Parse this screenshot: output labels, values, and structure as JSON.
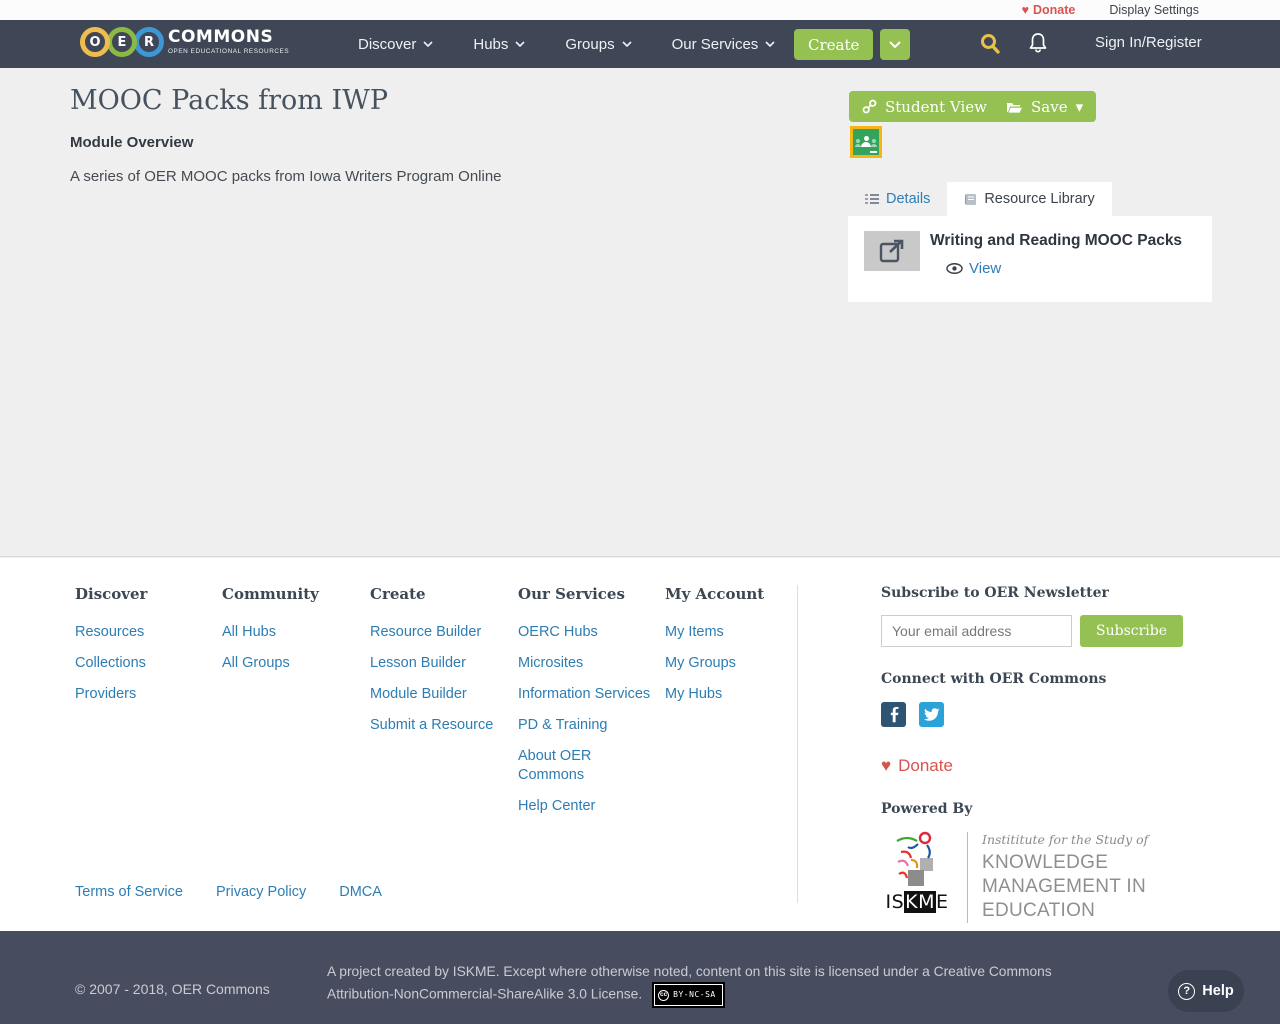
{
  "utility_bar": {
    "donate_label": "Donate",
    "display_settings_label": "Display Settings"
  },
  "header": {
    "logo": {
      "letter1": "O",
      "letter2": "E",
      "letter3": "R",
      "title": "COMMONS",
      "subtitle": "OPEN EDUCATIONAL RESOURCES"
    },
    "nav": [
      {
        "label": "Discover"
      },
      {
        "label": "Hubs"
      },
      {
        "label": "Groups"
      },
      {
        "label": "Our Services"
      }
    ],
    "create_label": "Create",
    "sign_in_label": "Sign In/Register"
  },
  "main": {
    "title": "MOOC Packs from IWP",
    "section_heading": "Module Overview",
    "description": "A series of OER MOOC packs from Iowa Writers Program Online",
    "student_view_label": "Student View",
    "save_label": "Save",
    "tabs": [
      {
        "label": "Details"
      },
      {
        "label": "Resource Library"
      }
    ],
    "resource": {
      "title": "Writing and Reading MOOC Packs",
      "view_label": "View"
    }
  },
  "footer": {
    "columns": [
      {
        "heading": "Discover",
        "links": [
          "Resources",
          "Collections",
          "Providers"
        ]
      },
      {
        "heading": "Community",
        "links": [
          "All Hubs",
          "All Groups"
        ]
      },
      {
        "heading": "Create",
        "links": [
          "Resource Builder",
          "Lesson Builder",
          "Module Builder",
          "Submit a Resource"
        ]
      },
      {
        "heading": "Our Services",
        "links": [
          "OERC Hubs",
          "Microsites",
          "Information Services",
          "PD & Training",
          "About OER Commons",
          "Help Center"
        ]
      },
      {
        "heading": "My Account",
        "links": [
          "My Items",
          "My Groups",
          "My Hubs"
        ]
      }
    ],
    "newsletter": {
      "heading": "Subscribe to OER Newsletter",
      "placeholder": "Your email address",
      "button_label": "Subscribe"
    },
    "connect_heading": "Connect with OER Commons",
    "donate_label": "Donate",
    "powered_by_heading": "Powered By",
    "iskme": {
      "name_part1": "IS",
      "name_part2": "KM",
      "name_part3": "E",
      "tagline": "Instititute for the Study of",
      "org_name": "KNOWLEDGE MANAGEMENT IN EDUCATION"
    },
    "legal_links": [
      "Terms of Service",
      "Privacy Policy",
      "DMCA"
    ]
  },
  "bottom_bar": {
    "copyright": "© 2007 - 2018, OER Commons",
    "license_text": "A project created by ISKME. Except where otherwise noted, content on this site is licensed under a Creative Commons Attribution-NonCommercial-ShareAlike 3.0 License.",
    "cc_icon_label": "cc",
    "cc_badge_label": "BY-NC-SA",
    "help_icon_glyph": "?",
    "help_label": "Help"
  },
  "icons": {
    "heart": "♥",
    "caret_down": "▾"
  },
  "colors": {
    "accent_green": "#94c152",
    "header_navy": "#3f4757",
    "bottom_navy": "#474d5e",
    "link_blue": "#2d7db3",
    "donate_red": "#d9534f",
    "title_slate": "#46525e",
    "page_bg": "#efefef"
  }
}
